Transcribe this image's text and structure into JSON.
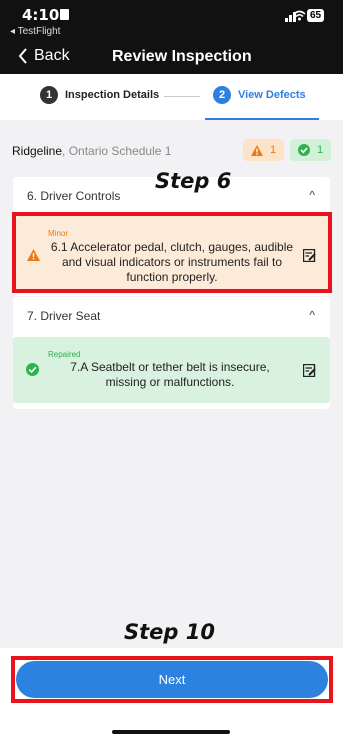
{
  "status_bar": {
    "time": "4:10",
    "back_app": "◂ TestFlight",
    "battery": "65"
  },
  "nav": {
    "back_label": "Back",
    "title": "Review Inspection"
  },
  "stepper": {
    "steps": [
      {
        "number": "1",
        "label": "Inspection Details"
      },
      {
        "number": "2",
        "label": "View Defects"
      }
    ]
  },
  "inspection": {
    "vehicle": "Ridgeline",
    "schedule": ", Ontario Schedule 1",
    "warning_count": "1",
    "ok_count": "1"
  },
  "sections": [
    {
      "title": "6. Driver Controls",
      "defect": {
        "severity": "Minor",
        "text_lines": [
          "6.1 Accelerator pedal, clutch, gauges, audible",
          "and visual indicators or instruments fail to",
          "function properly."
        ]
      }
    },
    {
      "title": "7. Driver Seat",
      "defect": {
        "severity": "Repaired",
        "text_lines": [
          "7.A Seatbelt or tether belt is insecure,",
          "missing or malfunctions."
        ]
      }
    }
  ],
  "annotations": {
    "step6": "Step 6",
    "step10": "Step 10"
  },
  "footer": {
    "next_label": "Next"
  },
  "colors": {
    "accent": "#2e82df",
    "minor_bg": "#fdebd9",
    "minor_text": "#e97a1a",
    "repaired_bg": "#d9f1df",
    "repaired_text": "#2eb34e",
    "highlight": "#e8141b"
  }
}
